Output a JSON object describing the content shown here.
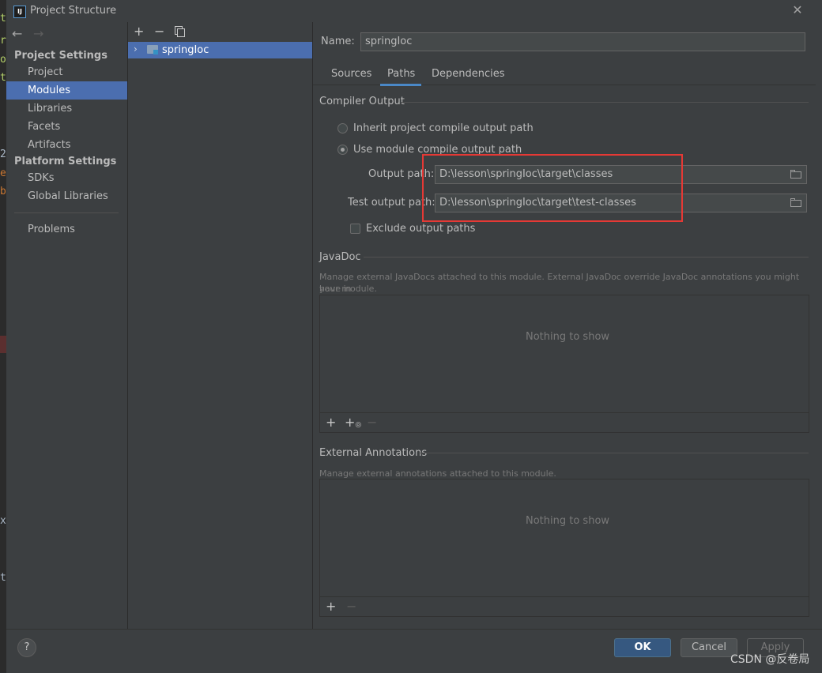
{
  "window": {
    "title": "Project Structure"
  },
  "nav": {
    "project_settings_header": "Project Settings",
    "project_settings_items": [
      "Project",
      "Modules",
      "Libraries",
      "Facets",
      "Artifacts"
    ],
    "platform_settings_header": "Platform Settings",
    "platform_settings_items": [
      "SDKs",
      "Global Libraries"
    ],
    "problems": "Problems",
    "selected": "Modules"
  },
  "tree": {
    "module_name": "springIoc"
  },
  "module": {
    "name_label": "Name:",
    "name_value": "springIoc",
    "tabs": [
      "Sources",
      "Paths",
      "Dependencies"
    ],
    "active_tab": "Paths"
  },
  "compiler_output": {
    "title": "Compiler Output",
    "inherit_label": "Inherit project compile output path",
    "use_module_label": "Use module compile output path",
    "output_path_label": "Output path:",
    "output_path_value": "D:\\lesson\\springIoc\\target\\classes",
    "test_output_path_label": "Test output path:",
    "test_output_path_value": "D:\\lesson\\springIoc\\target\\test-classes",
    "exclude_label": "Exclude output paths"
  },
  "javadoc": {
    "title": "JavaDoc",
    "description_line1": "Manage external JavaDocs attached to this module. External JavaDoc override JavaDoc annotations you might have in",
    "description_line2": "your module.",
    "empty": "Nothing to show"
  },
  "external_annotations": {
    "title": "External Annotations",
    "description": "Manage external annotations attached to this module.",
    "empty": "Nothing to show"
  },
  "buttons": {
    "ok": "OK",
    "cancel": "Cancel",
    "apply": "Apply",
    "help": "?"
  },
  "watermark": "CSDN @反卷局",
  "background_glyphs": [
    "t",
    "r",
    "o",
    "t",
    "2",
    "e",
    "b",
    "x",
    "t"
  ],
  "colors": {
    "accent": "#4b6eaf",
    "highlight_box": "#e53935",
    "primary_button": "#365880"
  }
}
